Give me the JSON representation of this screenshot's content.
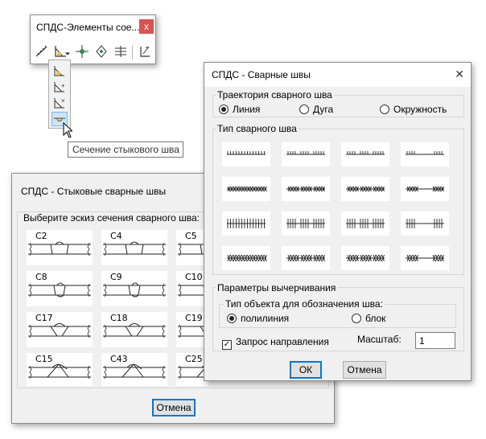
{
  "toolbar": {
    "title": "СПДС-Элементы сое...",
    "close_label": "x",
    "icons": [
      "weld-line-icon",
      "angle-icon",
      "node-point-icon",
      "diamond-node-icon",
      "grid-lines-icon",
      "axis-mark-icon"
    ]
  },
  "flyout": {
    "icons": [
      "angle-weld-icon",
      "angle-weld-plus-icon",
      "angle-weld-x-icon",
      "butt-weld-section-icon"
    ],
    "tooltip": "Сечение стыкового шва"
  },
  "butt_dialog": {
    "title": "СПДС - Стыковые сварные швы",
    "group_label": "Выберите эскиз сечения сварного шва:",
    "rows": [
      [
        "С2",
        "С4",
        "С5"
      ],
      [
        "С8",
        "С9",
        "С10"
      ],
      [
        "С17",
        "С18",
        "С19"
      ],
      [
        "С15",
        "С43",
        "С25 -"
      ]
    ],
    "cancel_label": "Отмена"
  },
  "weld_dialog": {
    "title": "СПДС - Сварные швы",
    "close_label": "✕",
    "trajectory": {
      "label": "Траектория сварного шва",
      "options": [
        {
          "label": "Линия",
          "selected": true
        },
        {
          "label": "Дуга",
          "selected": false
        },
        {
          "label": "Окружность",
          "selected": false
        }
      ]
    },
    "type_group_label": "Тип сварного шва",
    "params": {
      "label": "Параметры вычерчивания",
      "object_label": "Тип объекта для обозначения шва:",
      "object_options": [
        {
          "label": "полилиния",
          "selected": true
        },
        {
          "label": "блок",
          "selected": false
        }
      ],
      "direction_label": "Запрос направления",
      "direction_checked": true,
      "scale_label": "Масштаб:",
      "scale_value": "1"
    },
    "ok_label": "ОК",
    "cancel_label": "Отмена"
  }
}
